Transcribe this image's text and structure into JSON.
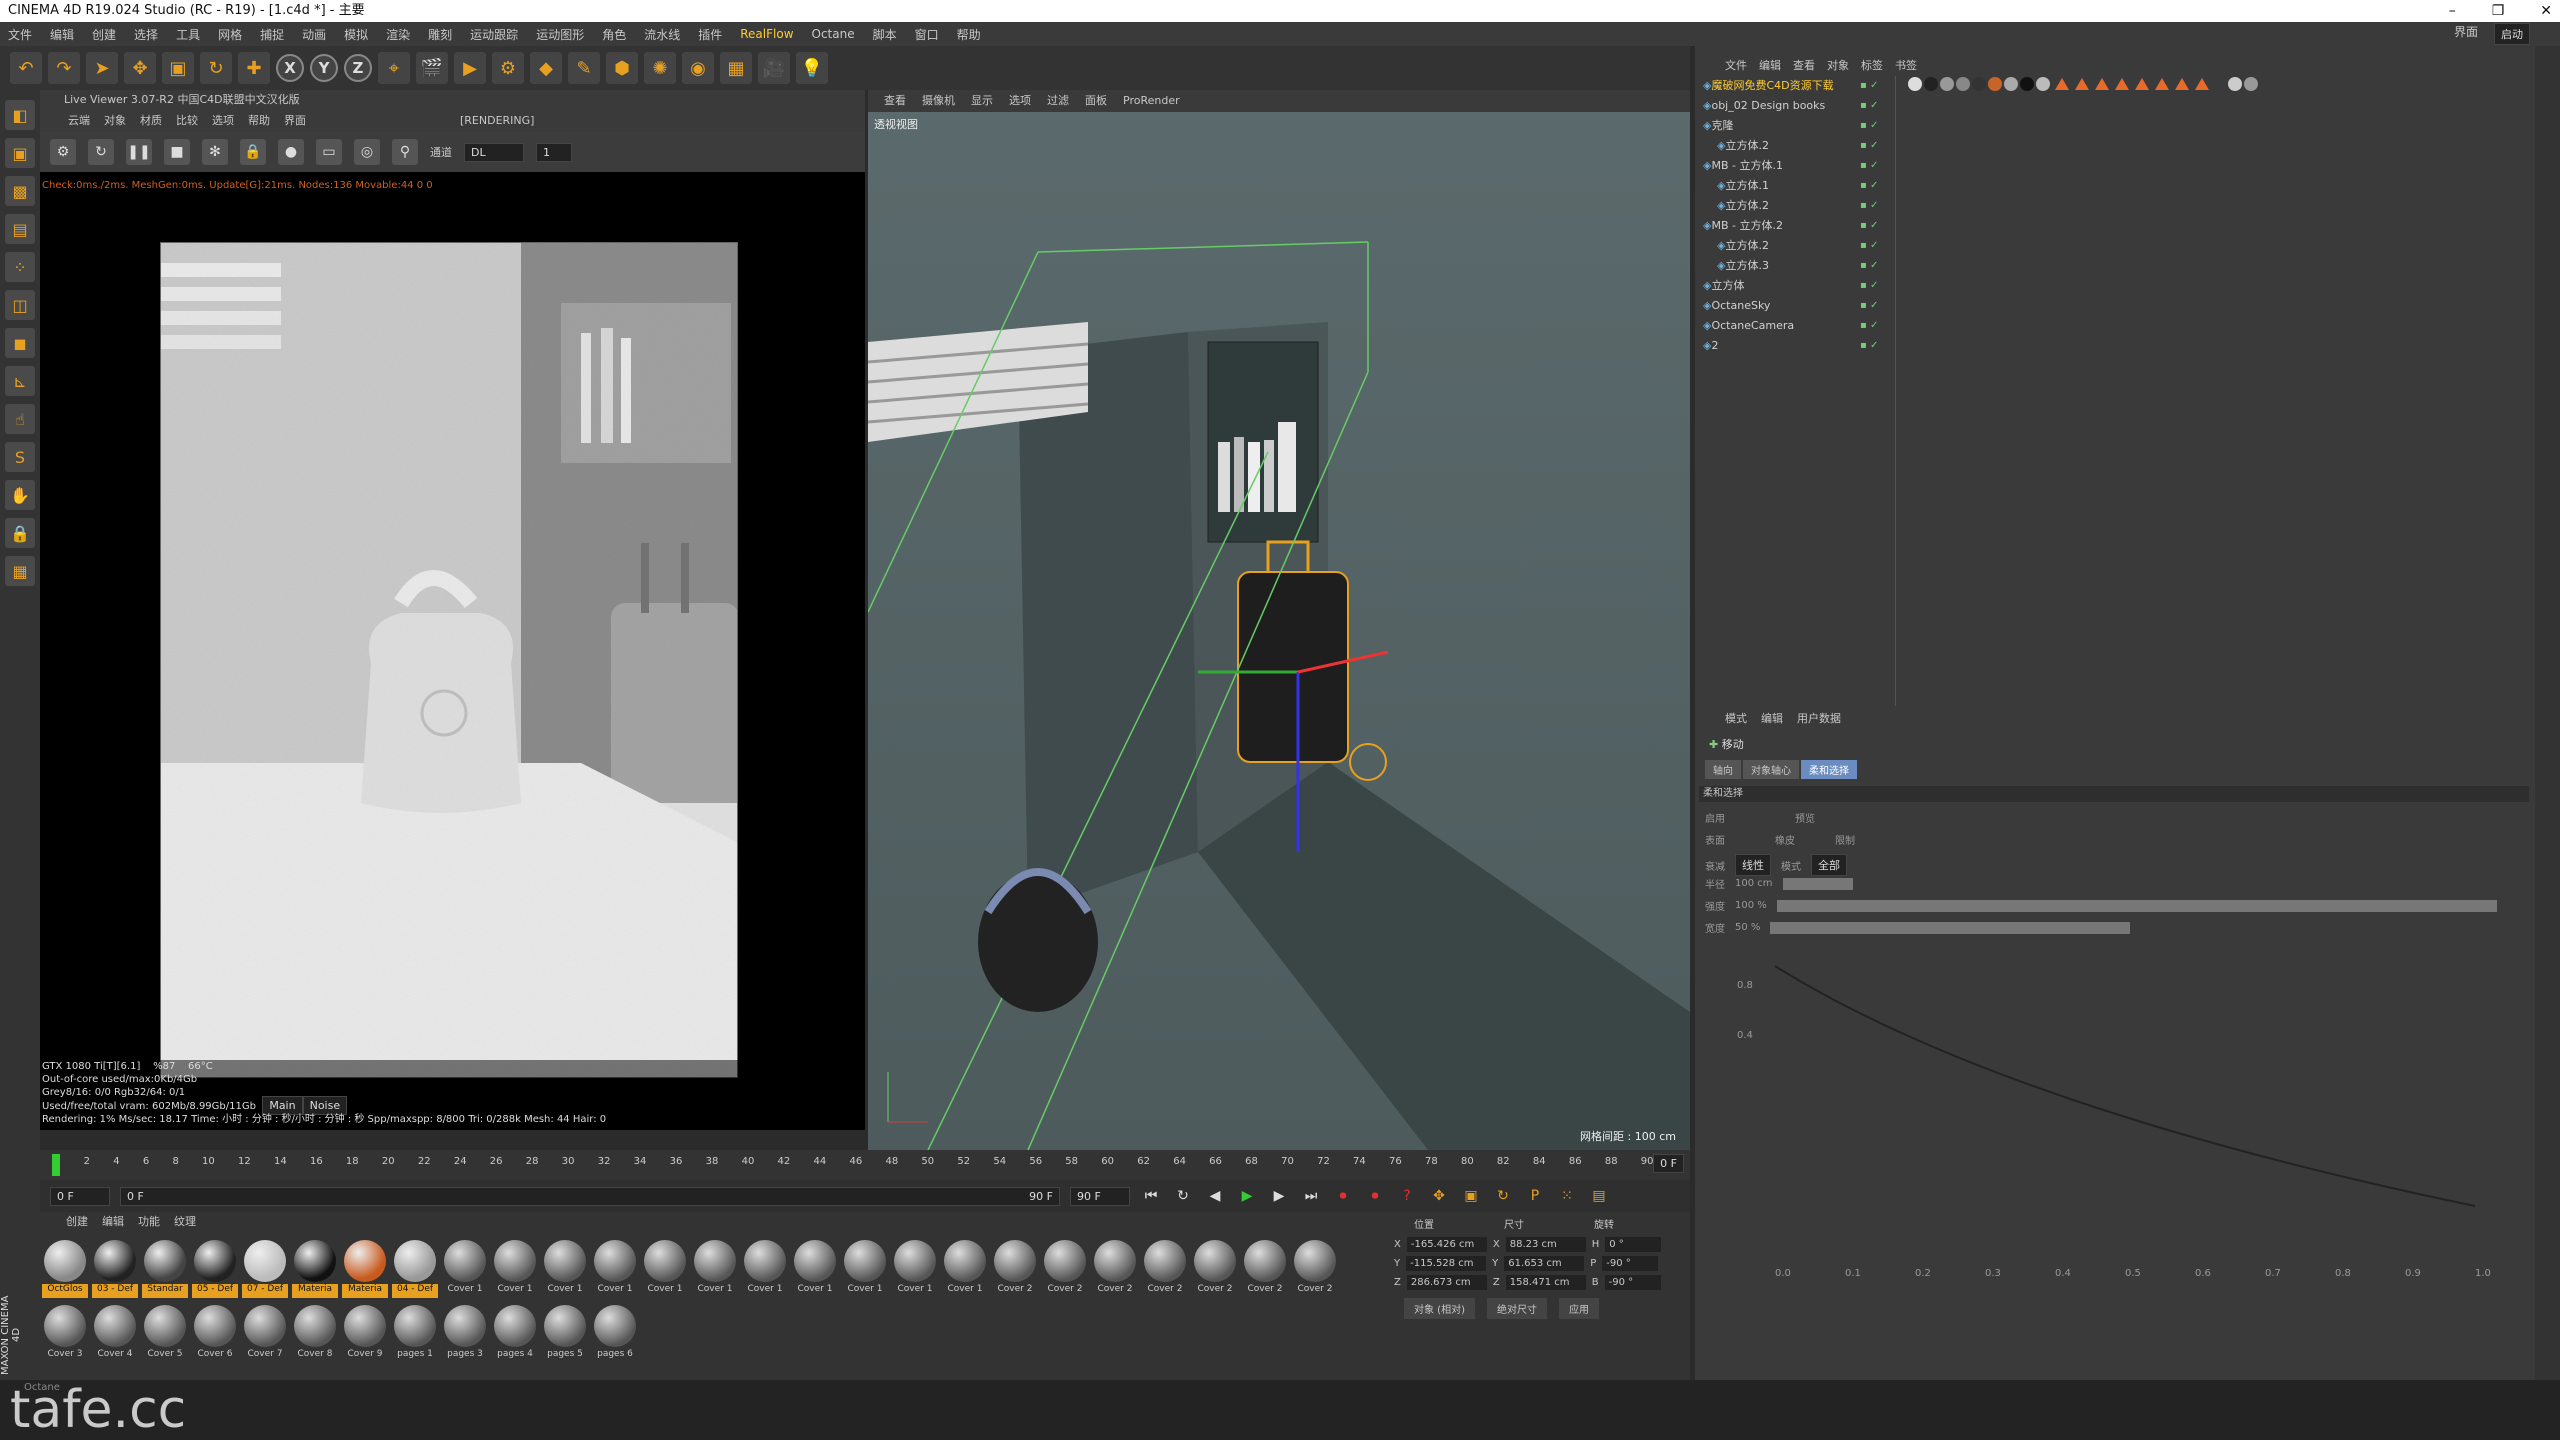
{
  "titlebar": {
    "title": "CINEMA 4D R19.024 Studio (RC - R19) - [1.c4d *] - 主要",
    "minimize": "–",
    "maximize": "❐",
    "close": "✕"
  },
  "menubar": {
    "items": [
      "文件",
      "编辑",
      "创建",
      "选择",
      "工具",
      "网格",
      "捕捉",
      "动画",
      "模拟",
      "渲染",
      "雕刻",
      "运动跟踪",
      "运动图形",
      "角色",
      "流水线",
      "插件",
      "RealFlow",
      "Octane",
      "脚本",
      "窗口",
      "帮助"
    ],
    "right_label": "界面",
    "right_value": "启动"
  },
  "liveviewer": {
    "title": "Live Viewer 3.07-R2 中国C4D联盟中文汉化版",
    "menu": [
      "云端",
      "对象",
      "材质",
      "比较",
      "选项",
      "帮助",
      "界面"
    ],
    "rendering_label": "[RENDERING]",
    "channel_label": "通道",
    "channel_value": "DL",
    "channel_num": "1",
    "status": "Check:0ms./2ms. MeshGen:0ms. Update[G]:21ms. Nodes:136 Movable:44 0 0",
    "stats": {
      "gpu": "GTX 1080 Ti[T][6.1]",
      "gpu_pct": "%87",
      "gpu_temp": "66°C",
      "line2": "Out-of-core used/max:0Kb/4Gb",
      "line3": "Grey8/16: 0/0         Rgb32/64: 0/1",
      "line4": "Used/free/total vram: 602Mb/8.99Gb/11Gb",
      "tab_main": "Main",
      "tab_noise": "Noise",
      "line5": "Rendering: 1%   Ms/sec: 18.17   Time: 小时 : 分钟 : 秒/小时 : 分钟 : 秒   Spp/maxspp: 8/800   Tri: 0/288k   Mesh: 44   Hair: 0"
    }
  },
  "viewport": {
    "menu": [
      "查看",
      "摄像机",
      "显示",
      "选项",
      "过滤",
      "面板",
      "ProRender"
    ],
    "label": "透视视图",
    "grid_label": "网格间距 : 100 cm"
  },
  "timeline": {
    "ticks": [
      "0",
      "2",
      "4",
      "6",
      "8",
      "10",
      "12",
      "14",
      "16",
      "18",
      "20",
      "22",
      "24",
      "26",
      "28",
      "30",
      "32",
      "34",
      "36",
      "38",
      "40",
      "42",
      "44",
      "46",
      "48",
      "50",
      "52",
      "54",
      "56",
      "58",
      "60",
      "62",
      "64",
      "66",
      "68",
      "70",
      "72",
      "74",
      "76",
      "78",
      "80",
      "82",
      "84",
      "86",
      "88",
      "90"
    ],
    "current_frame_right": "0 F"
  },
  "playbar": {
    "start": "0 F",
    "range_start": "0 F",
    "range_end": "90 F",
    "end": "90 F"
  },
  "materials": {
    "menu": [
      "创建",
      "编辑",
      "功能",
      "纹理"
    ],
    "items": [
      {
        "label": "OctGlos",
        "selected": true
      },
      {
        "label": "03 - Def",
        "selected": true
      },
      {
        "label": "Standar",
        "selected": true
      },
      {
        "label": "05 - Def",
        "selected": true
      },
      {
        "label": "07 - Def",
        "selected": true
      },
      {
        "label": "Materia",
        "selected": true
      },
      {
        "label": "Materia",
        "selected": true
      },
      {
        "label": "04 - Def",
        "selected": true
      },
      {
        "label": "Cover 1",
        "selected": false
      },
      {
        "label": "Cover 1",
        "selected": false
      },
      {
        "label": "Cover 1",
        "selected": false
      },
      {
        "label": "Cover 1",
        "selected": false
      },
      {
        "label": "Cover 1",
        "selected": false
      },
      {
        "label": "Cover 1",
        "selected": false
      },
      {
        "label": "Cover 1",
        "selected": false
      },
      {
        "label": "Cover 1",
        "selected": false
      },
      {
        "label": "Cover 1",
        "selected": false
      },
      {
        "label": "Cover 1",
        "selected": false
      },
      {
        "label": "Cover 1",
        "selected": false
      },
      {
        "label": "Cover 2",
        "selected": false
      },
      {
        "label": "Cover 2",
        "selected": false
      },
      {
        "label": "Cover 2",
        "selected": false
      },
      {
        "label": "Cover 2",
        "selected": false
      },
      {
        "label": "Cover 2",
        "selected": false
      },
      {
        "label": "Cover 2",
        "selected": false
      },
      {
        "label": "Cover 2",
        "selected": false
      },
      {
        "label": "Cover 3",
        "selected": false
      },
      {
        "label": "Cover 4",
        "selected": false
      },
      {
        "label": "Cover 5",
        "selected": false
      },
      {
        "label": "Cover 6",
        "selected": false
      },
      {
        "label": "Cover 7",
        "selected": false
      },
      {
        "label": "Cover 8",
        "selected": false
      },
      {
        "label": "Cover 9",
        "selected": false
      },
      {
        "label": "pages 1",
        "selected": false
      },
      {
        "label": "pages 3",
        "selected": false
      },
      {
        "label": "pages 4",
        "selected": false
      },
      {
        "label": "pages 5",
        "selected": false
      },
      {
        "label": "pages 6",
        "selected": false
      }
    ]
  },
  "coords": {
    "hdr_pos": "位置",
    "hdr_size": "尺寸",
    "hdr_rot": "旋转",
    "rows": [
      {
        "axis": "X",
        "pos": "-165.426 cm",
        "size_axis": "X",
        "size": "88.23 cm",
        "rot_axis": "H",
        "rot": "0 °"
      },
      {
        "axis": "Y",
        "pos": "-115.528 cm",
        "size_axis": "Y",
        "size": "61.653 cm",
        "rot_axis": "P",
        "rot": "-90 °"
      },
      {
        "axis": "Z",
        "pos": "286.673 cm",
        "size_axis": "Z",
        "size": "158.471 cm",
        "rot_axis": "B",
        "rot": "-90 °"
      }
    ],
    "mode1": "对象 (相对)",
    "mode2": "绝对尺寸",
    "apply": "应用"
  },
  "objects": {
    "menu": [
      "文件",
      "编辑",
      "查看",
      "对象",
      "标签",
      "书签"
    ],
    "rows": [
      {
        "name": "魔破网免费C4D资源下载",
        "indent": 0,
        "hl": true
      },
      {
        "name": "obj_02 Design books",
        "indent": 0,
        "hl": false
      },
      {
        "name": "克隆",
        "indent": 0,
        "hl": false
      },
      {
        "name": "立方体.2",
        "indent": 1,
        "hl": false
      },
      {
        "name": "MB - 立方体.1",
        "indent": 0,
        "hl": false
      },
      {
        "name": "立方体.1",
        "indent": 1,
        "hl": false
      },
      {
        "name": "立方体.2",
        "indent": 1,
        "hl": false
      },
      {
        "name": "MB - 立方体.2",
        "indent": 0,
        "hl": false
      },
      {
        "name": "立方体.2",
        "indent": 1,
        "hl": false
      },
      {
        "name": "立方体.3",
        "indent": 1,
        "hl": false
      },
      {
        "name": "立方体",
        "indent": 0,
        "hl": false
      },
      {
        "name": "OctaneSky",
        "indent": 0,
        "hl": false
      },
      {
        "name": "OctaneCamera",
        "indent": 0,
        "hl": false
      },
      {
        "name": "2",
        "indent": 0,
        "hl": false
      }
    ]
  },
  "attributes": {
    "menu": [
      "模式",
      "编辑",
      "用户数据"
    ],
    "mode_title": "移动",
    "tabs": [
      "轴向",
      "对象轴心",
      "柔和选择"
    ],
    "active_tab": 2,
    "section": "柔和选择",
    "opt1": "启用",
    "opt2": "预览",
    "opt3": "表面",
    "opt4": "橡皮",
    "opt5": "限制",
    "opt6": "衰减",
    "opt6_val": "线性",
    "opt7": "模式",
    "opt7_val": "全部",
    "s_radius": "半径",
    "s_radius_val": "100 cm",
    "s_strength": "强度",
    "s_strength_val": "100 %",
    "s_width": "宽度",
    "s_width_val": "50 %",
    "curve_y": [
      "0.8",
      "0.4"
    ],
    "curve_x": [
      "0.0",
      "0.1",
      "0.2",
      "0.3",
      "0.4",
      "0.5",
      "0.6",
      "0.7",
      "0.8",
      "0.9",
      "1.0"
    ]
  },
  "watermark": "tafe.cc",
  "maxon": "MAXON CINEMA 4D",
  "octane_label": "Octane"
}
